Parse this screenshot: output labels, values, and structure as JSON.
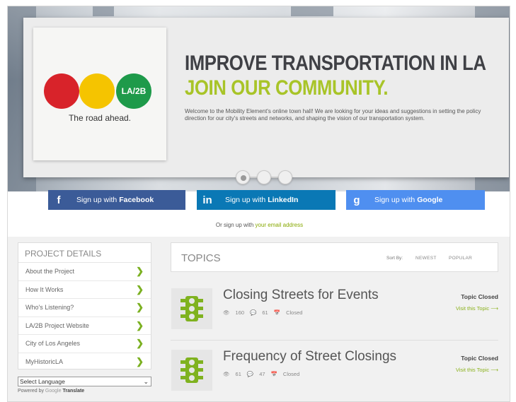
{
  "hero": {
    "logo_badge": "LA/2B",
    "logo_tagline": "The road ahead.",
    "title_line1": "IMPROVE TRANSPORTATION IN LA",
    "title_line2": "JOIN OUR COMMUNITY.",
    "body": "Welcome to the Mobility Element's online town hall! We are looking for your ideas and suggestions in setting the policy direction for our city's streets and networks, and shaping the vision of our transportation system.",
    "slides_count": 3,
    "active_slide": 1
  },
  "signup": {
    "facebook": {
      "prefix": "Sign up with",
      "brand": "Facebook",
      "icon": "f"
    },
    "linkedin": {
      "prefix": "Sign up with",
      "brand": "LinkedIn",
      "icon": "in"
    },
    "google": {
      "prefix": "Sign up with",
      "brand": "Google",
      "icon": "g"
    },
    "or_text": "Or sign up with",
    "email_link": "your email address"
  },
  "project_details": {
    "heading": "PROJECT DETAILS",
    "items": [
      {
        "label": "About the Project"
      },
      {
        "label": "How It Works"
      },
      {
        "label": "Who's Listening?"
      },
      {
        "label": "LA/2B Project Website"
      },
      {
        "label": "City of Los Angeles"
      },
      {
        "label": "MyHistoricLA"
      }
    ]
  },
  "language": {
    "select_value": "Select Language",
    "powered_by": "Powered by",
    "google": "Google",
    "translate": "Translate"
  },
  "topics": {
    "heading": "TOPICS",
    "sort_by": "Sort By:",
    "sort_options": [
      "NEWEST",
      "POPULAR"
    ],
    "items": [
      {
        "title": "Closing Streets for Events",
        "views": "160",
        "comments": "61",
        "status": "Closed",
        "badge": "Topic Closed",
        "link": "Visit this Topic"
      },
      {
        "title": "Frequency of Street Closings",
        "views": "61",
        "comments": "47",
        "status": "Closed",
        "badge": "Topic Closed",
        "link": "Visit this Topic"
      }
    ]
  },
  "colors": {
    "accent_green": "#a8c428",
    "facebook": "#3b5b98",
    "linkedin": "#0a78b5",
    "google": "#4f8ff0",
    "logo_red": "#d8232a",
    "logo_yellow": "#f5c400",
    "logo_green": "#1e9a4a"
  }
}
